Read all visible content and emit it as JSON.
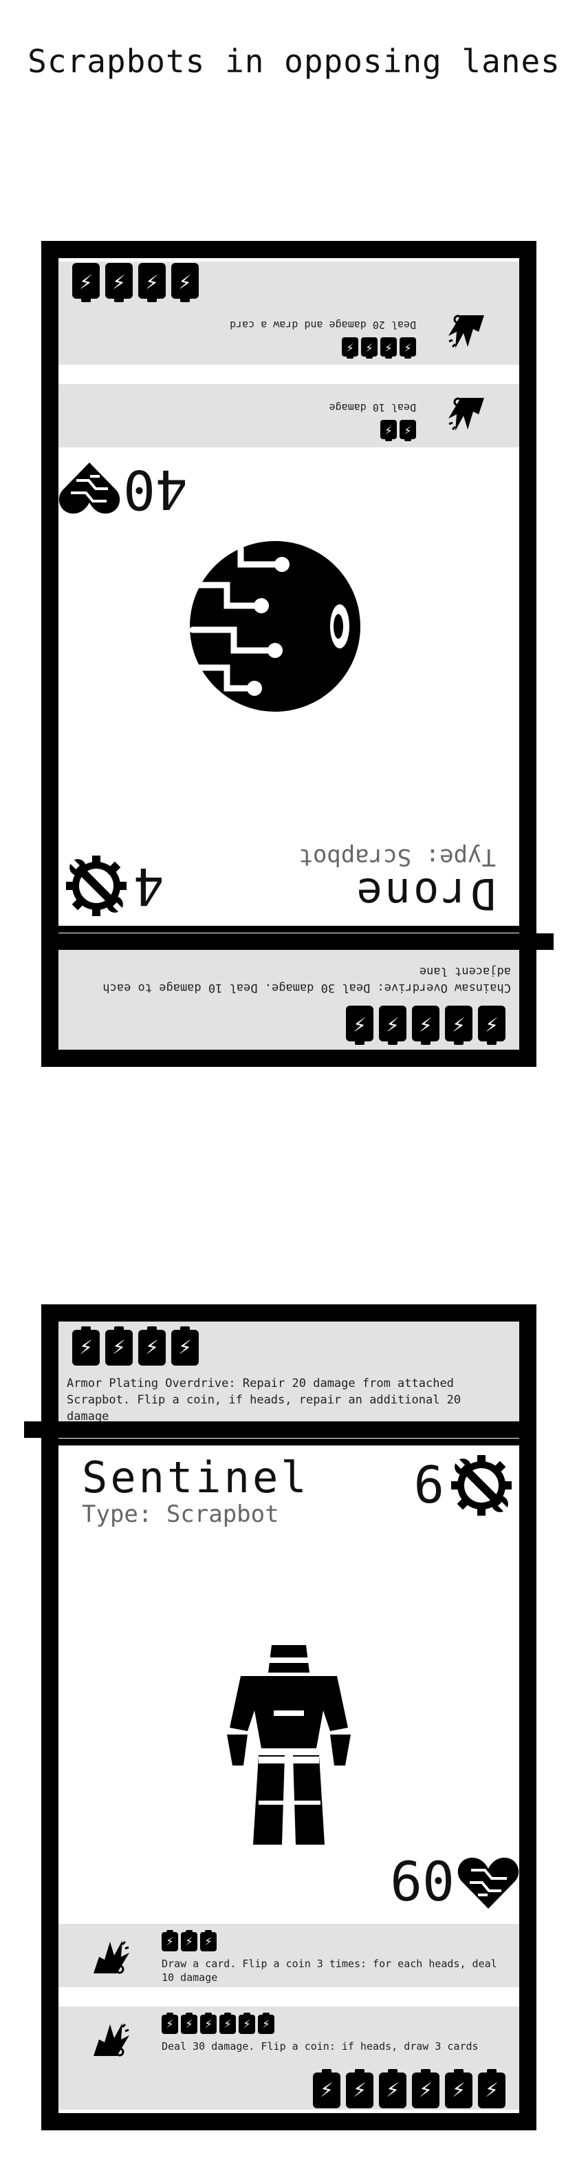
{
  "page_title": "Scrapbots in opposing lanes",
  "cards": [
    {
      "name": "Drone",
      "type_line": "Type: Scrapbot",
      "hp": "4",
      "armor": "40",
      "overdrive_cost": 5,
      "overdrive_text": "Chainsaw Overdrive: Deal 30 damage. Deal 10 damage to each adjacent lane",
      "attacks": [
        {
          "cost": 2,
          "text": "Deal 10 damage"
        },
        {
          "cost": 4,
          "text": "Deal 20 damage and draw a card"
        }
      ],
      "retreat_cost": 4
    },
    {
      "name": "Sentinel",
      "type_line": "Type: Scrapbot",
      "hp": "6",
      "armor": "60",
      "overdrive_cost": 4,
      "overdrive_text": "Armor Plating Overdrive: Repair 20 damage from attached Scrapbot. Flip a coin, if heads, repair an additional 20 damage",
      "attacks": [
        {
          "cost": 3,
          "text": "Draw a card. Flip a coin 3 times: for each heads, deal 10 damage"
        },
        {
          "cost": 6,
          "text": "Deal 30 damage. Flip a coin: if heads, draw 3 cards"
        }
      ],
      "retreat_cost": 6
    }
  ]
}
